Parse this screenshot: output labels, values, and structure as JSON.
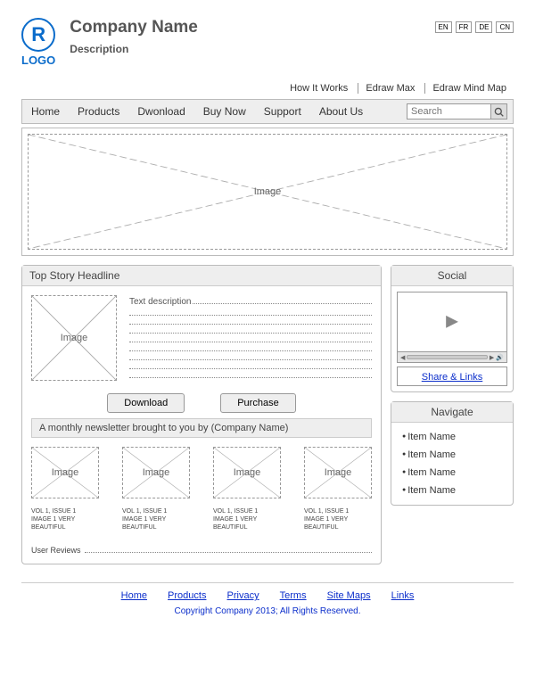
{
  "header": {
    "logo_text": "LOGO",
    "logo_glyph": "R",
    "title": "Company Name",
    "description": "Description",
    "languages": [
      "EN",
      "FR",
      "DE",
      "CN"
    ],
    "links": [
      "How It Works",
      "Edraw Max",
      "Edraw Mind Map"
    ]
  },
  "nav": {
    "items": [
      "Home",
      "Products",
      "Dwonload",
      "Buy Now",
      "Support",
      "About Us"
    ],
    "search_placeholder": "Search"
  },
  "hero": {
    "image_label": "Image"
  },
  "story": {
    "headline": "Top Story Headline",
    "image_label": "Image",
    "text_lead": "Text description",
    "download_label": "Download",
    "purchase_label": "Purchase"
  },
  "newsletter": {
    "heading": "A monthly newsletter brought to you by (Company Name)",
    "thumbs": [
      {
        "img": "Image",
        "cap1": "VOL 1, ISSUE 1",
        "cap2": "IMAGE 1 VERY",
        "cap3": "BEAUTIFUL"
      },
      {
        "img": "Image",
        "cap1": "VOL 1, ISSUE 1",
        "cap2": "IMAGE 1 VERY",
        "cap3": "BEAUTIFUL"
      },
      {
        "img": "Image",
        "cap1": "VOL 1, ISSUE 1",
        "cap2": "IMAGE 1 VERY",
        "cap3": "BEAUTIFUL"
      },
      {
        "img": "Image",
        "cap1": "VOL 1, ISSUE 1",
        "cap2": "IMAGE 1 VERY",
        "cap3": "BEAUTIFUL"
      }
    ],
    "reviews_label": "User Reviews"
  },
  "sidebar": {
    "social_heading": "Social",
    "share_label": "Share & Links",
    "navigate_heading": "Navigate",
    "navigate_items": [
      "Item Name",
      "Item Name",
      "Item Name",
      "Item Name"
    ]
  },
  "footer": {
    "links": [
      "Home",
      "Products",
      "Privacy",
      "Terms",
      "Site Maps",
      "Links"
    ],
    "copyright": "Copyright Company 2013; All Rights Reserved."
  }
}
